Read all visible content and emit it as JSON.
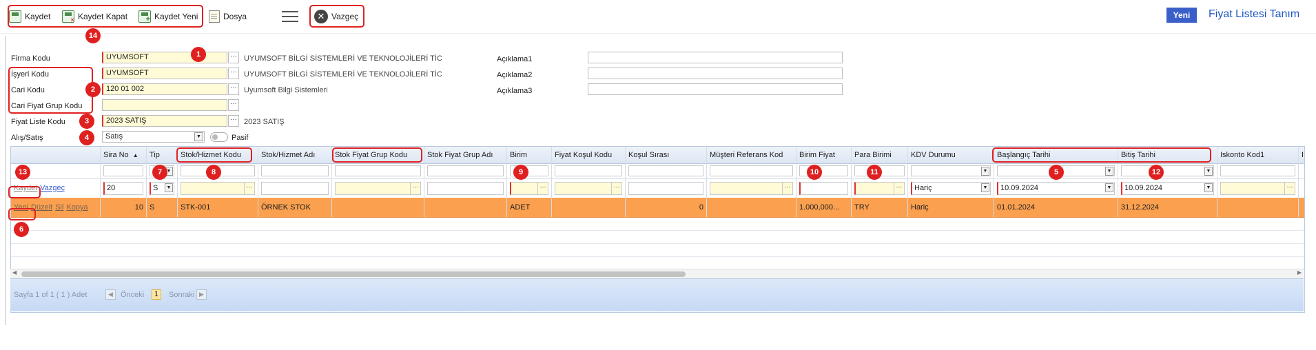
{
  "toolbar": {
    "kaydet": "Kaydet",
    "kaydet_kapat": "Kaydet Kapat",
    "kaydet_yeni": "Kaydet Yeni",
    "dosya": "Dosya",
    "vazgec": "Vazgeç",
    "yeni": "Yeni",
    "page_title": "Fiyat Listesi Tanım"
  },
  "form": {
    "firma_kodu": {
      "label": "Firma Kodu",
      "value": "UYUMSOFT",
      "desc": "UYUMSOFT BİLGİ SİSTEMLERİ VE TEKNOLOJİLERİ TİC"
    },
    "isyeri_kodu": {
      "label": "İşyeri Kodu",
      "value": "UYUMSOFT",
      "desc": "UYUMSOFT BİLGİ SİSTEMLERİ VE TEKNOLOJİLERİ TİC"
    },
    "cari_kodu": {
      "label": "Cari Kodu",
      "value": "120 01 002",
      "desc": "Uyumsoft Bilgi Sistemleri"
    },
    "cari_fiyat_grup_kodu": {
      "label": "Cari Fiyat Grup Kodu",
      "value": ""
    },
    "fiyat_liste_kodu": {
      "label": "Fiyat Liste Kodu",
      "value": "2023 SATIŞ",
      "desc": "2023 SATIŞ"
    },
    "alis_satis": {
      "label": "Alış/Satış",
      "value": "Satış"
    },
    "pasif": "Pasif",
    "aciklama1": {
      "label": "Açıklama1",
      "value": ""
    },
    "aciklama2": {
      "label": "Açıklama2",
      "value": ""
    },
    "aciklama3": {
      "label": "Açıklama3",
      "value": ""
    }
  },
  "grid": {
    "columns": [
      "",
      "Sira No",
      "Tip",
      "Stok/Hizmet Kodu",
      "Stok/Hizmet Adı",
      "Stok Fiyat Grup Kodu",
      "Stok Fiyat Grup Adı",
      "Birim",
      "Fiyat Koşul Kodu",
      "Koşul Sırası",
      "Müşteri Referans Kod",
      "Birim Fiyat",
      "Para Birimi",
      "KDV Durumu",
      "Başlangıç Tarihi",
      "Bitiş Tarihi",
      "Iskonto Kod1",
      "I"
    ],
    "edit_row": {
      "kaydet": "Kaydet",
      "vazgec": "Vazgeç",
      "sira_no": "20",
      "tip": "S",
      "kdv_durumu": "Hariç",
      "baslangic": "10.09.2024",
      "bitis": "10.09.2024"
    },
    "row_actions": {
      "yeni": "Yeni",
      "duzelt": "Düzelt",
      "sil": "Sil",
      "kopya": "Kopya"
    },
    "rows": [
      {
        "sira_no": "10",
        "tip": "S",
        "stok_kodu": "STK-001",
        "stok_adi": "ÖRNEK STOK",
        "birim": "ADET",
        "kosul_sirasi": "0",
        "birim_fiyat": "1.000,000...",
        "para_birimi": "TRY",
        "kdv_durumu": "Hariç",
        "baslangic": "01.01.2024",
        "bitis": "31.12.2024"
      }
    ]
  },
  "pager": {
    "info": "Sayfa 1 of 1 ( 1 ) Adet",
    "prev": "Önceki",
    "current": "1",
    "next": "Sonraki"
  },
  "badges": [
    "1",
    "2",
    "3",
    "4",
    "5",
    "6",
    "7",
    "8",
    "9",
    "10",
    "11",
    "12",
    "13",
    "14"
  ]
}
